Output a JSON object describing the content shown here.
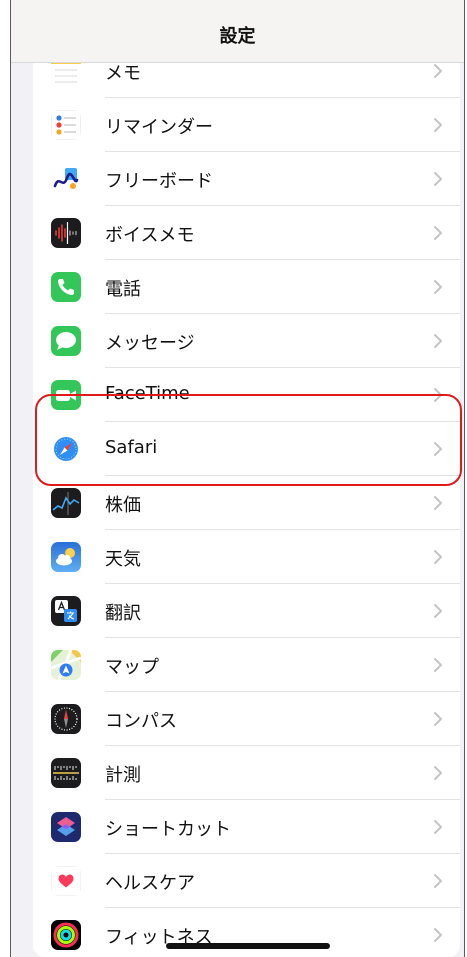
{
  "nav": {
    "title": "設定"
  },
  "items": [
    {
      "label": "メモ",
      "icon": "notes-icon"
    },
    {
      "label": "リマインダー",
      "icon": "reminders-icon"
    },
    {
      "label": "フリーボード",
      "icon": "freeform-icon"
    },
    {
      "label": "ボイスメモ",
      "icon": "voice-memos-icon"
    },
    {
      "label": "電話",
      "icon": "phone-icon"
    },
    {
      "label": "メッセージ",
      "icon": "messages-icon"
    },
    {
      "label": "FaceTime",
      "icon": "facetime-icon"
    },
    {
      "label": "Safari",
      "icon": "safari-icon"
    },
    {
      "label": "株価",
      "icon": "stocks-icon"
    },
    {
      "label": "天気",
      "icon": "weather-icon"
    },
    {
      "label": "翻訳",
      "icon": "translate-icon"
    },
    {
      "label": "マップ",
      "icon": "maps-icon"
    },
    {
      "label": "コンパス",
      "icon": "compass-icon"
    },
    {
      "label": "計測",
      "icon": "measure-icon"
    },
    {
      "label": "ショートカット",
      "icon": "shortcuts-icon"
    },
    {
      "label": "ヘルスケア",
      "icon": "health-icon"
    },
    {
      "label": "フィットネス",
      "icon": "fitness-icon"
    }
  ],
  "colors": {
    "highlight": "#e0191d",
    "background": "#f2f2f6",
    "chevron": "#c4c4c7"
  }
}
